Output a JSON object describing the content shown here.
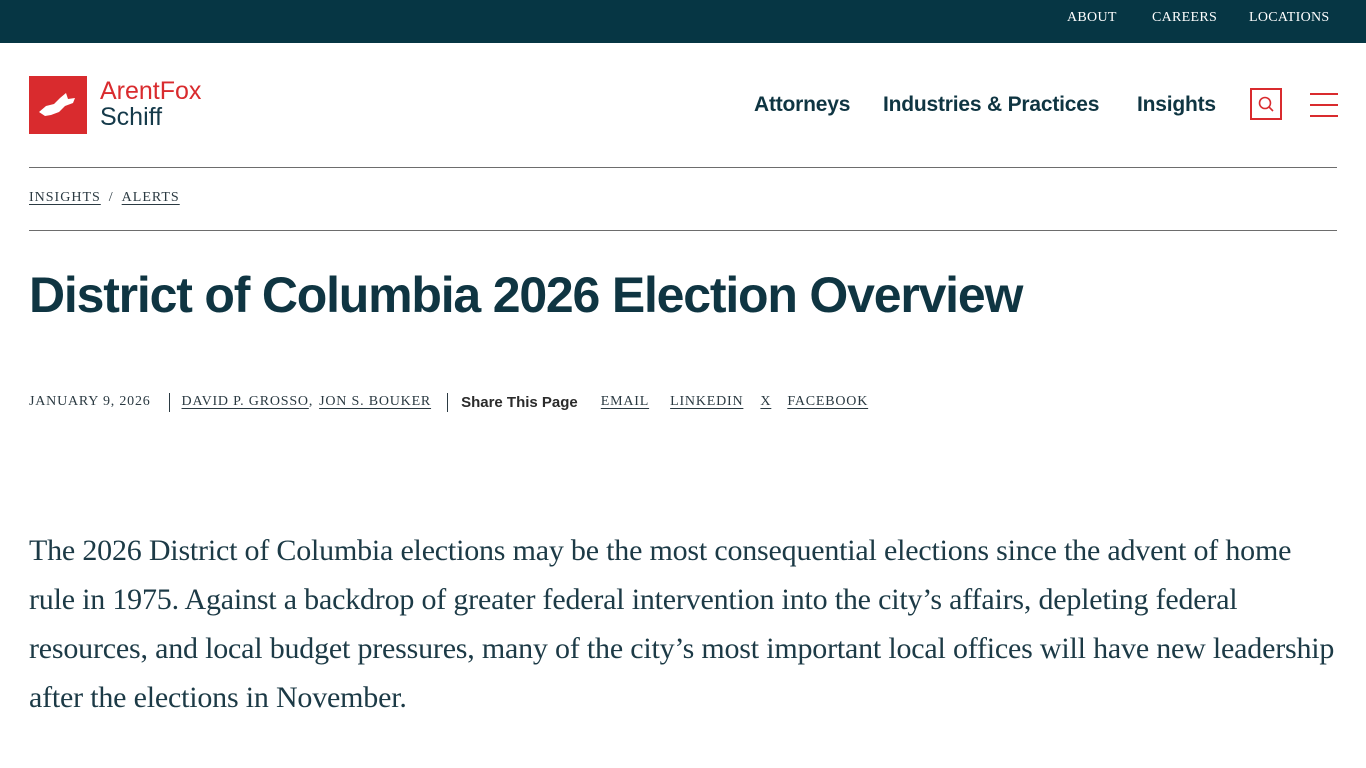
{
  "utility_nav": {
    "about": "ABOUT",
    "careers": "CAREERS",
    "locations": "LOCATIONS"
  },
  "brand": {
    "line1": "ArentFox",
    "line2": "Schiff",
    "color_red": "#d92b2e",
    "color_navy": "#063644"
  },
  "main_nav": {
    "attorneys": "Attorneys",
    "industries": "Industries & Practices",
    "insights": "Insights"
  },
  "icons": {
    "search": "search-icon",
    "menu": "hamburger-menu-icon",
    "logo": "fox-logo-icon"
  },
  "breadcrumb": {
    "item1": "INSIGHTS",
    "separator": "/",
    "item2": "ALERTS"
  },
  "article": {
    "title": "District of Columbia 2026 Election Overview",
    "date": "JANUARY 9, 2026",
    "author1": "DAVID P. GROSSO",
    "author_sep": ",",
    "author2": "JON S. BOUKER",
    "share_label": "Share This Page",
    "share": {
      "email": "EMAIL",
      "linkedin": "LINKEDIN",
      "x": "X",
      "facebook": "FACEBOOK"
    },
    "lead": "The 2026 District of Columbia elections may be the most consequential elections since the advent of home rule in 1975. Against a backdrop of greater federal intervention into the city’s affairs, depleting federal resources, and local budget pressures, many of the city’s most important local offices will have new leadership after the elections in November."
  }
}
